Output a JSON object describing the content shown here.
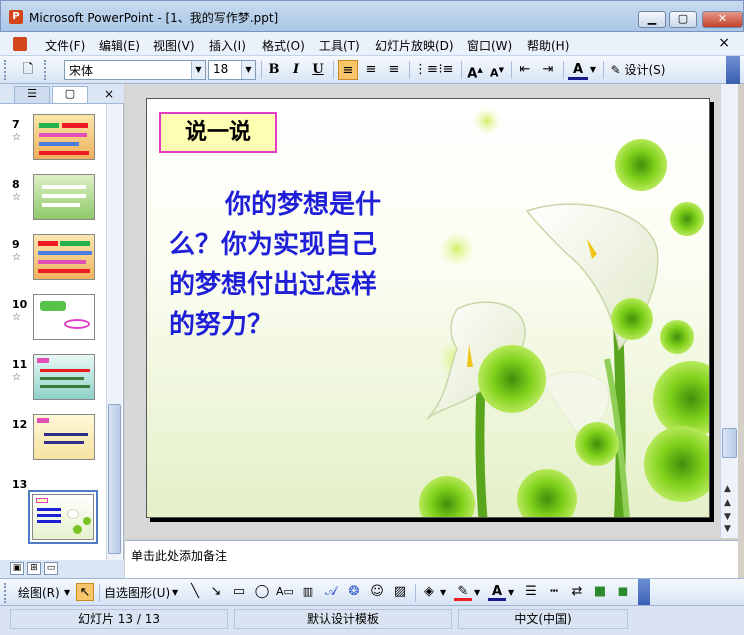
{
  "window": {
    "title": "Microsoft PowerPoint - [1、我的写作梦.ppt]",
    "app_icon": "powerpoint-icon"
  },
  "menu": {
    "items": [
      "文件(F)",
      "编辑(E)",
      "视图(V)",
      "插入(I)",
      "格式(O)",
      "工具(T)",
      "幻灯片放映(D)",
      "窗口(W)",
      "帮助(H)"
    ],
    "close": "×"
  },
  "toolbar": {
    "font_name": "宋体",
    "font_size": "18",
    "bold": "B",
    "italic": "I",
    "underline": "U",
    "design_label": "设计(S)"
  },
  "left_pane": {
    "close": "×",
    "slides": [
      {
        "number": "7",
        "starred": true
      },
      {
        "number": "8",
        "starred": true
      },
      {
        "number": "9",
        "starred": true
      },
      {
        "number": "10",
        "starred": true
      },
      {
        "number": "11",
        "starred": true
      },
      {
        "number": "12",
        "starred": false
      },
      {
        "number": "13",
        "starred": false
      }
    ]
  },
  "slide": {
    "title": "说一说",
    "question": "你的梦想是什么？你为实现自己的梦想付出过怎样的努力？"
  },
  "notes": {
    "placeholder": "单击此处添加备注"
  },
  "drawing_toolbar": {
    "draw_menu": "绘图(R)",
    "autoshapes_menu": "自选图形(U)"
  },
  "status": {
    "slide_info": "幻灯片 13 / 13",
    "template": "默认设计模板",
    "language": "中文(中国)"
  },
  "colors": {
    "question_text": "#1f1fd8",
    "title_box_fill": "#ffffb3",
    "title_box_border": "#e43ac4",
    "selected_slide_border": "#4f7cc5"
  }
}
